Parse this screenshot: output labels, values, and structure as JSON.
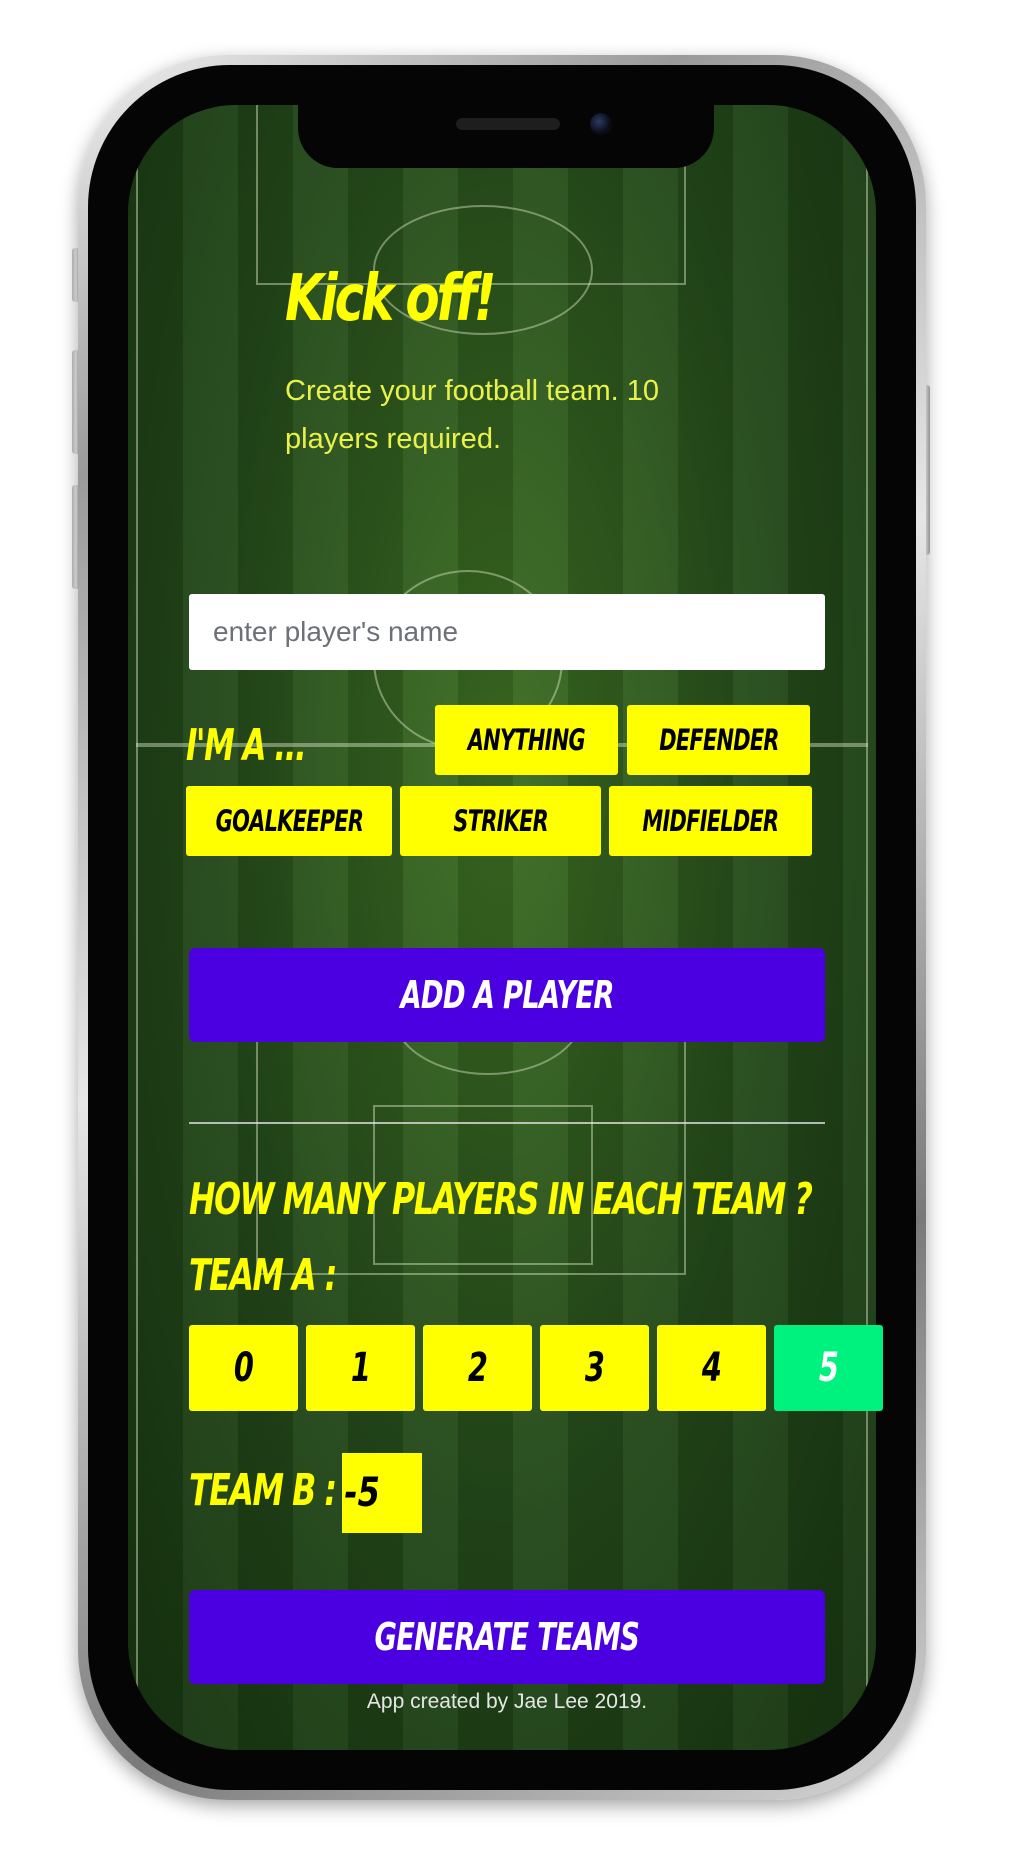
{
  "app": {
    "title": "Kick off!",
    "subtitle": "Create your football team. 10 players required."
  },
  "player_form": {
    "name_placeholder": "enter player's name",
    "name_value": "",
    "role_label": "I'M A ...",
    "positions": [
      "ANYTHING",
      "DEFENDER",
      "GOALKEEPER",
      "STRIKER",
      "MIDFIELDER"
    ],
    "add_button": "ADD A PLAYER"
  },
  "teams": {
    "question": "HOW MANY PLAYERS IN EACH TEAM ?",
    "team_a_label": "TEAM A :",
    "team_a_options": [
      "0",
      "1",
      "2",
      "3",
      "4",
      "5"
    ],
    "team_a_selected": "5",
    "team_b_label": "TEAM B :",
    "team_b_value": "-5",
    "generate_button": "GENERATE TEAMS"
  },
  "footer": "App created by Jae Lee 2019.",
  "colors": {
    "accent_yellow": "#ffff00",
    "button_purple": "#4a00e0",
    "selected_green": "#00f27e",
    "pitch_green": "#23481a"
  }
}
